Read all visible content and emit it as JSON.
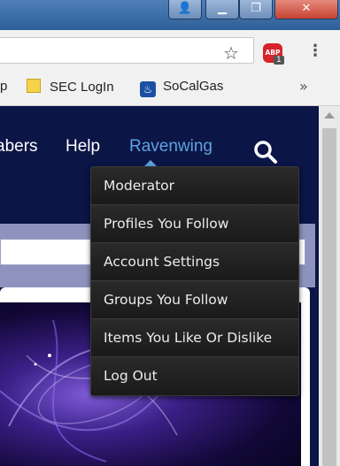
{
  "window": {
    "controls": [
      "user",
      "minimize",
      "maximize",
      "close"
    ],
    "control_glyphs": {
      "user": "👤",
      "minimize": "▁",
      "maximize": "❐",
      "close": "✕"
    }
  },
  "toolbar": {
    "omnibox_value": "",
    "star_icon": "☆",
    "extension": {
      "label": "ABP",
      "badge_count": "1"
    },
    "menu_icon": "⋮"
  },
  "bookmarks": {
    "partial": "p",
    "items": [
      {
        "label": "SEC LogIn",
        "icon": "folder-icon"
      },
      {
        "label": "SoCalGas",
        "icon": "socalgas-flame-icon"
      }
    ],
    "overflow": "»"
  },
  "site": {
    "nav": {
      "members_partial": "abers",
      "help": "Help",
      "username": "Ravenwing"
    },
    "colors": {
      "background": "#0b1546",
      "accent": "#5ea2df",
      "menu_bg": "#1d1d1d"
    }
  },
  "user_menu": {
    "items": [
      "Moderator",
      "Profiles You Follow",
      "Account Settings",
      "Groups You Follow",
      "Items You Like Or Dislike",
      "Log Out"
    ]
  }
}
